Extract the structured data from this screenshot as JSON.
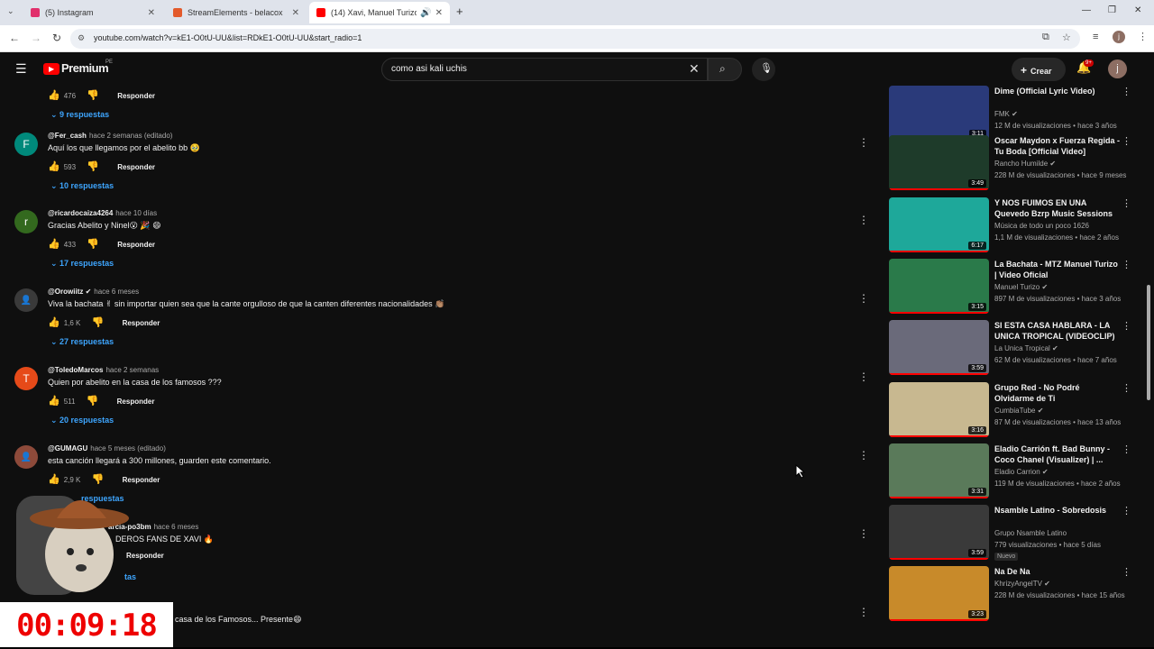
{
  "browser": {
    "tabs": [
      {
        "title": "(5) Instagram",
        "color": "#e1306c"
      },
      {
        "title": "StreamElements - belacox",
        "color": "#e35a2b"
      },
      {
        "title": "(14) Xavi, Manuel Turizo - E",
        "color": "#ff0000"
      }
    ],
    "url": "youtube.com/watch?v=kE1-O0tU-UU&list=RDkE1-O0tU-UU&start_radio=1"
  },
  "header": {
    "logo": "Premium",
    "region": "PE",
    "search_value": "como asi kali uchis",
    "create_label": "Crear",
    "notif_count": "9+",
    "avatar_letter": "j"
  },
  "comments": [
    {
      "likes": "476",
      "reply_label": "Responder",
      "replies": "9 respuestas"
    },
    {
      "avatar": "F",
      "avatar_color": "#00897b",
      "user": "@Fer_cash",
      "time": "hace 2 semanas (editado)",
      "text": "Aquí los que llegamos por el abelito bb 🥹",
      "likes": "593",
      "reply_label": "Responder",
      "replies": "10 respuestas"
    },
    {
      "avatar": "r",
      "avatar_color": "#33691e",
      "user": "@ricardocaiza4264",
      "time": "hace 10 días",
      "text": "Gracias Abelito y Ninel😮 🎉 😄",
      "likes": "433",
      "reply_label": "Responder",
      "replies": "17 respuestas"
    },
    {
      "avatar": "",
      "avatar_color": "#3a3a3a",
      "user": "@Orowiitz ✔",
      "time": "hace 6 meses",
      "text": "Viva la bachata ✌ sin importar quien sea que la cante orgulloso de que la canten diferentes nacionalidades 👏🏽",
      "likes": "1,6 K",
      "reply_label": "Responder",
      "replies": "27 respuestas"
    },
    {
      "avatar": "T",
      "avatar_color": "#e64a19",
      "user": "@ToledoMarcos",
      "time": "hace 2 semanas",
      "text": "Quien por abelito en la casa de los famosos ???",
      "likes": "511",
      "reply_label": "Responder",
      "replies": "20 respuestas"
    },
    {
      "avatar": "",
      "avatar_color": "#8d4a3a",
      "user": "@GUMAGU",
      "time": "hace 5 meses (editado)",
      "text": "esta canción llegará a 300 millones, guarden este comentario.",
      "likes": "2,9 K",
      "reply_label": "Responder",
      "replies": "respuestas"
    },
    {
      "avatar": "",
      "avatar_color": "#555",
      "user": "arcia-po3bm",
      "time": "hace 6 meses",
      "text": "DEROS FANS DE XAVI 🔥",
      "likes": "",
      "reply_label": "Responder",
      "replies": "tas"
    },
    {
      "avatar": "",
      "avatar_color": "#555",
      "user": "",
      "time": "",
      "text": "casa de los Famosos... Presente😄",
      "likes": "",
      "reply_label": "",
      "replies": ""
    }
  ],
  "videos": [
    {
      "title": "Dime (Official Lyric Video)",
      "channel": "FMK ✔",
      "views": "12 M de visualizaciones • hace 3 años",
      "duration": "3:11",
      "color": "#2a3a7a"
    },
    {
      "title": "Oscar Maydon x Fuerza Regida - Tu Boda [Official Video]",
      "channel": "Rancho Humilde ✔",
      "views": "228 M de visualizaciones • hace 9 meses",
      "duration": "3:49",
      "color": "#1e3b2a"
    },
    {
      "title": "Y NOS FUIMOS EN UNA Quevedo Bzrp Music Sessions",
      "channel": "Música de todo un poco 1626",
      "views": "1,1 M de visualizaciones • hace 2 años",
      "duration": "6:17",
      "color": "#1ea89a"
    },
    {
      "title": "La Bachata - MTZ Manuel Turizo | Video Oficial",
      "channel": "Manuel Turizo ✔",
      "views": "897 M de visualizaciones • hace 3 años",
      "duration": "3:15",
      "color": "#2a7a4a"
    },
    {
      "title": "SI ESTA CASA HABLARA - LA UNICA TROPICAL (VIDEOCLIP)",
      "channel": "La Unica Tropical ✔",
      "views": "62 M de visualizaciones • hace 7 años",
      "duration": "3:59",
      "color": "#6a6a7a"
    },
    {
      "title": "Grupo Red - No Podré Olvidarme de Ti",
      "channel": "CumbiaTube ✔",
      "views": "87 M de visualizaciones • hace 13 años",
      "duration": "3:16",
      "color": "#c8b890"
    },
    {
      "title": "Eladio Carrión ft. Bad Bunny - Coco Chanel (Visualizer) | ...",
      "channel": "Eladio Carrion ✔",
      "views": "119 M de visualizaciones • hace 2 años",
      "duration": "3:31",
      "color": "#5a7a5a"
    },
    {
      "title": "Nsamble Latino - Sobredosis",
      "channel": "Grupo Nsamble Latino",
      "views": "779 visualizaciones • hace 5 días",
      "duration": "3:59",
      "badge": "Nuevo",
      "color": "#3a3a3a"
    },
    {
      "title": "Na De Na",
      "channel": "KhrizyAngelTV ✔",
      "views": "228 M de visualizaciones • hace 15 años",
      "duration": "3:23",
      "color": "#c88a2a"
    }
  ],
  "timer": "00:09:18"
}
